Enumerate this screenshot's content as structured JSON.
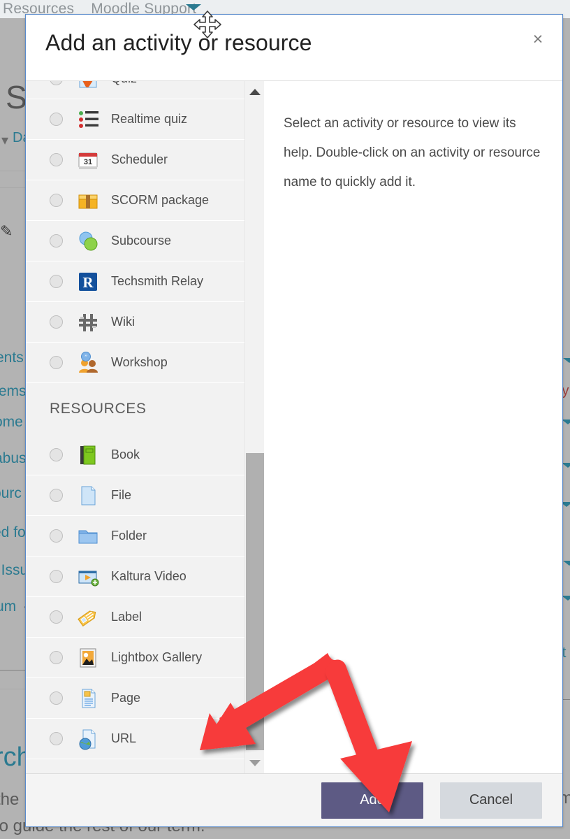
{
  "background": {
    "topnav_items": [
      "Resources",
      "Moodle Support"
    ],
    "heading_fragment": "S",
    "nav_fragment": "Da",
    "left_fragments": [
      "ents",
      "tems",
      "ome",
      "abus",
      "ourc",
      "ed fo",
      "t Issu",
      "um"
    ],
    "search_fragment": "rch",
    "bottom_line_1_fragment": "the",
    "bottom_line_2": "to guide the rest of our term.",
    "right_fragments": [
      "ly",
      "it",
      "m"
    ]
  },
  "modal": {
    "title": "Add an activity or resource",
    "close_label": "×",
    "help_text": "Select an activity or resource to view its help. Double-click on an activity or resource name to quickly add it.",
    "sections": [
      {
        "heading": "",
        "items": [
          {
            "label": "Quiz",
            "icon": "quiz-icon",
            "selected": false
          },
          {
            "label": "Realtime quiz",
            "icon": "realtime-quiz-icon",
            "selected": false
          },
          {
            "label": "Scheduler",
            "icon": "scheduler-icon",
            "selected": false
          },
          {
            "label": "SCORM package",
            "icon": "scorm-package-icon",
            "selected": false
          },
          {
            "label": "Subcourse",
            "icon": "subcourse-icon",
            "selected": false
          },
          {
            "label": "Techsmith Relay",
            "icon": "techsmith-relay-icon",
            "selected": false
          },
          {
            "label": "Wiki",
            "icon": "wiki-icon",
            "selected": false
          },
          {
            "label": "Workshop",
            "icon": "workshop-icon",
            "selected": false
          }
        ]
      },
      {
        "heading": "RESOURCES",
        "items": [
          {
            "label": "Book",
            "icon": "book-icon",
            "selected": false
          },
          {
            "label": "File",
            "icon": "file-icon",
            "selected": false
          },
          {
            "label": "Folder",
            "icon": "folder-icon",
            "selected": false
          },
          {
            "label": "Kaltura Video",
            "icon": "kaltura-video-icon",
            "selected": false
          },
          {
            "label": "Label",
            "icon": "label-icon",
            "selected": false
          },
          {
            "label": "Lightbox Gallery",
            "icon": "lightbox-gallery-icon",
            "selected": false
          },
          {
            "label": "Page",
            "icon": "page-icon",
            "selected": false
          },
          {
            "label": "URL",
            "icon": "url-icon",
            "selected": false
          }
        ]
      }
    ],
    "footer": {
      "add_label": "Add",
      "cancel_label": "Cancel"
    },
    "scrollbar": {
      "up_arrow": "scroll-up-arrow",
      "down_arrow": "scroll-down-arrow"
    }
  },
  "annotations": {
    "arrow_color": "#f73b3b",
    "arrows": [
      {
        "name": "arrow-pointing-to-scrollbar",
        "direction": "down-left"
      },
      {
        "name": "arrow-pointing-to-add-button",
        "direction": "down-right"
      }
    ],
    "cursor": "move-cursor"
  },
  "colors": {
    "primary_button": "#5d5a84",
    "secondary_button": "#d5d9de",
    "modal_border": "#5a8bcc",
    "list_background": "#f2f2f2",
    "accent_link": "#2b7a90"
  }
}
